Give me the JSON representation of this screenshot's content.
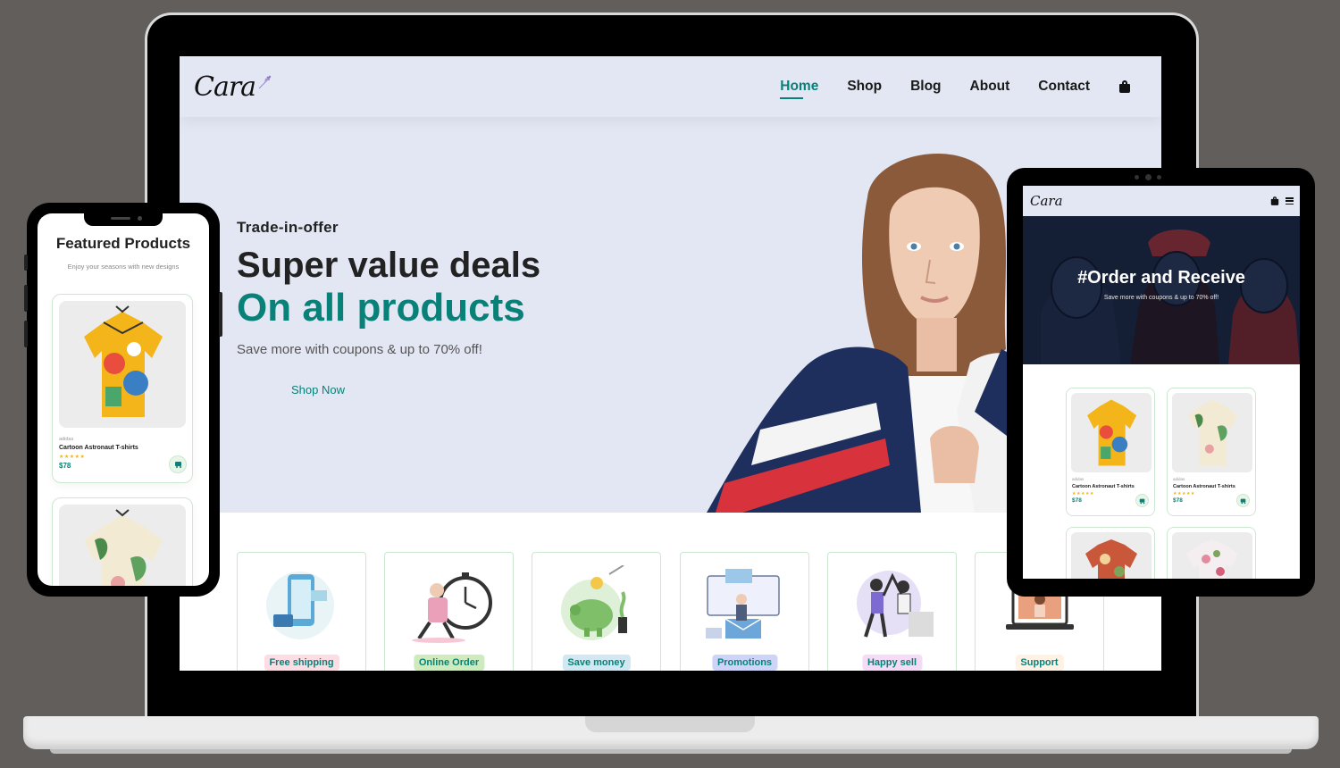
{
  "brand": {
    "logo": "Cara"
  },
  "laptop": {
    "nav": [
      {
        "label": "Home",
        "active": true
      },
      {
        "label": "Shop",
        "active": false
      },
      {
        "label": "Blog",
        "active": false
      },
      {
        "label": "About",
        "active": false
      },
      {
        "label": "Contact",
        "active": false
      }
    ],
    "hero": {
      "eyebrow": "Trade-in-offer",
      "title_line1": "Super value deals",
      "title_line2": "On all products",
      "subtitle": "Save more with coupons & up to 70% off!",
      "button": "Shop Now"
    },
    "features": [
      {
        "label": "Free shipping",
        "bg": "#fddde4",
        "icon": "phone-delivery-icon"
      },
      {
        "label": "Online Order",
        "bg": "#cdebbc",
        "icon": "stopwatch-courier-icon"
      },
      {
        "label": "Save money",
        "bg": "#d1e8f2",
        "icon": "piggy-bank-icon"
      },
      {
        "label": "Promotions",
        "bg": "#cdd4f8",
        "icon": "mail-promotion-icon"
      },
      {
        "label": "Happy sell",
        "bg": "#f6dbf6",
        "icon": "high-five-icon"
      },
      {
        "label": "Support",
        "bg": "#fff2e5",
        "icon": "laptop-support-icon"
      }
    ]
  },
  "phone": {
    "title": "Featured Products",
    "subtitle": "Enjoy your seasons with new designs",
    "product": {
      "brand": "adidas",
      "name": "Cartoon Astronaut T-shirts",
      "stars": "★★★★★",
      "price": "$78"
    }
  },
  "tablet": {
    "banner_title": "#Order and Receive",
    "banner_subtitle": "Save more with coupons & up to 70% off!",
    "products": [
      {
        "brand": "adidas",
        "name": "Cartoon Astronaut T-shirts",
        "stars": "★★★★★",
        "price": "$78"
      },
      {
        "brand": "adidas",
        "name": "Cartoon Astronaut T-shirts",
        "stars": "★★★★★",
        "price": "$78"
      }
    ]
  },
  "colors": {
    "accent": "#088178",
    "hero_bg": "#e3e6f3",
    "device_bg": "#615e5b"
  }
}
